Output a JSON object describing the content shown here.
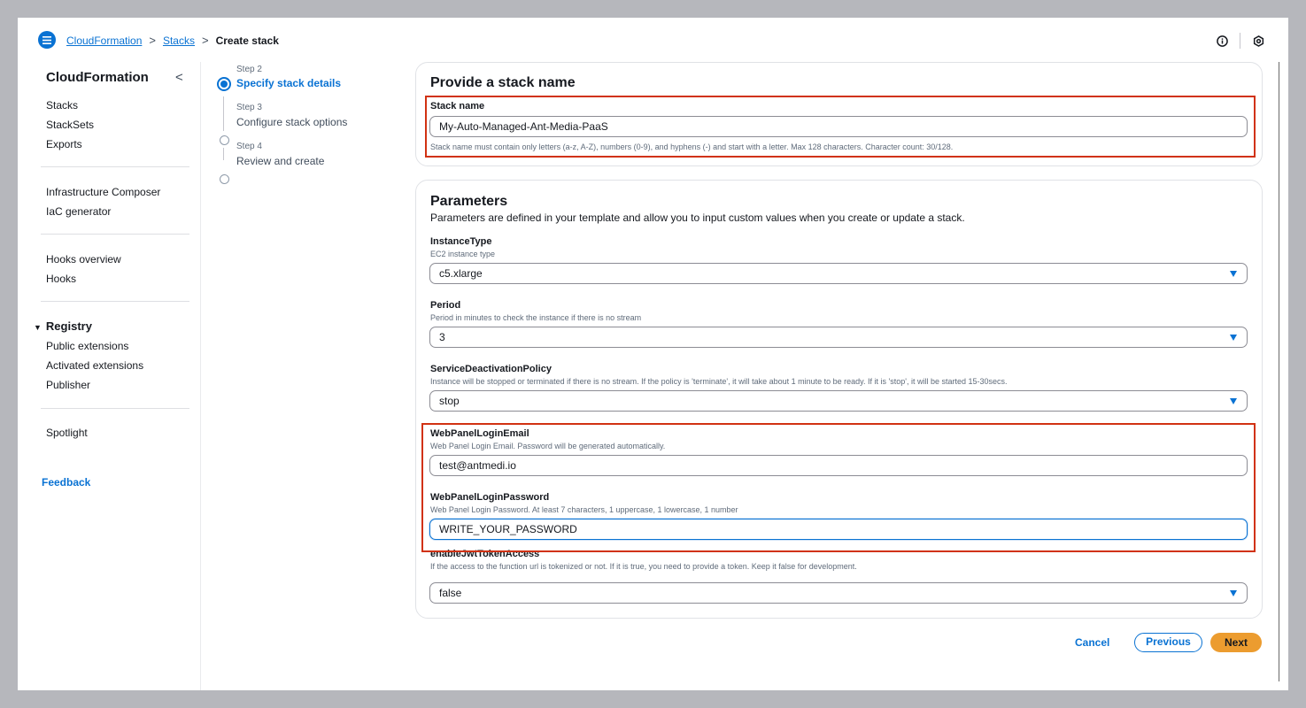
{
  "breadcrumb": {
    "items": [
      "CloudFormation",
      "Stacks"
    ],
    "separator": ">",
    "current": "Create stack"
  },
  "icons": {
    "menu": "hamburger-menu-icon",
    "info": "info-circle-icon",
    "settings": "settings-icon",
    "collapse": "chevron-left-icon",
    "dropdown": "caret-down-icon"
  },
  "sidebar": {
    "title": "CloudFormation",
    "collapse_glyph": "<",
    "group1": [
      "Stacks",
      "StackSets",
      "Exports"
    ],
    "group2": [
      "Infrastructure Composer",
      "IaC generator"
    ],
    "group3": [
      "Hooks overview",
      "Hooks"
    ],
    "registry": {
      "label": "Registry",
      "toggle": "▼",
      "items": [
        "Public extensions",
        "Activated extensions",
        "Publisher"
      ]
    },
    "group5": [
      "Spotlight"
    ],
    "feedback": "Feedback"
  },
  "steps": [
    {
      "small": "Step 2",
      "label": "Specify stack details",
      "active": true
    },
    {
      "small": "Step 3",
      "label": "Configure stack options",
      "active": false
    },
    {
      "small": "Step 4",
      "label": "Review and create",
      "active": false
    }
  ],
  "stack_name_panel": {
    "title": "Provide a stack name",
    "label": "Stack name",
    "value": "My-Auto-Managed-Ant-Media-PaaS",
    "hint": "Stack name must contain only letters (a-z, A-Z), numbers (0-9), and hyphens (-) and start with a letter. Max 128 characters. Character count: 30/128."
  },
  "parameters_panel": {
    "title": "Parameters",
    "description": "Parameters are defined in your template and allow you to input custom values when you create or update a stack.",
    "fields": [
      {
        "label": "InstanceType",
        "desc": "EC2 instance type",
        "value": "c5.xlarge",
        "type": "select"
      },
      {
        "label": "Period",
        "desc": "Period in minutes to check the instance if there is no stream",
        "value": "3",
        "type": "select"
      },
      {
        "label": "ServiceDeactivationPolicy",
        "desc": "Instance will be stopped or terminated if there is no stream. If the policy is 'terminate', it will take about 1 minute to be ready. If it is 'stop', it will be started 15-30secs.",
        "value": "stop",
        "type": "select"
      },
      {
        "label": "WebPanelLoginEmail",
        "desc": "Web Panel Login Email. Password will be generated automatically.",
        "value": "test@antmedi.io",
        "type": "text"
      },
      {
        "label": "WebPanelLoginPassword",
        "desc": "Web Panel Login Password. At least 7 characters, 1 uppercase, 1 lowercase, 1 number",
        "value": "WRITE_YOUR_PASSWORD",
        "type": "text"
      },
      {
        "label": "enableJwtTokenAccess",
        "desc": "If the access to the function url is tokenized or not. If it is true, you need to provide a token. Keep it false for development.",
        "value": "false",
        "type": "select"
      }
    ]
  },
  "footer": {
    "cancel": "Cancel",
    "previous": "Previous",
    "next": "Next"
  },
  "colors": {
    "link": "#0972d3",
    "primary_button": "#ec9c2f",
    "highlight": "#d13212",
    "background": "#b6b7bc"
  }
}
